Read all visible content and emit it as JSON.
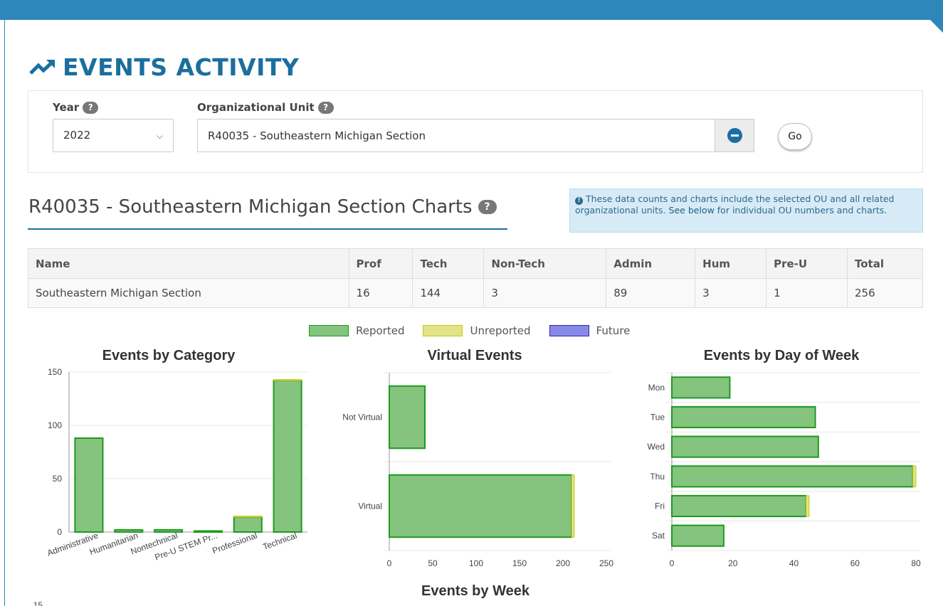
{
  "page": {
    "title": "EVENTS ACTIVITY",
    "title_icon": "trend-up-icon"
  },
  "filters": {
    "year_label": "Year",
    "year_value": "2022",
    "ou_label": "Organizational Unit",
    "ou_value": "R40035 - Southeastern Michigan Section",
    "help_glyph": "?",
    "go_label": "Go"
  },
  "section": {
    "title": "R40035 - Southeastern Michigan Section Charts",
    "info_icon": "info-icon",
    "info_text": "These data counts and charts include the selected OU and all related organizational units.",
    "info_link": "See below",
    "info_text2": "for individual OU numbers and charts."
  },
  "table": {
    "columns": [
      "Name",
      "Prof",
      "Tech",
      "Non-Tech",
      "Admin",
      "Hum",
      "Pre-U",
      "Total"
    ],
    "rows": [
      [
        "Southeastern Michigan Section",
        "16",
        "144",
        "3",
        "89",
        "3",
        "1",
        "256"
      ]
    ]
  },
  "legend": [
    {
      "label": "Reported",
      "color": "#85c47e",
      "border": "#1e9a1e"
    },
    {
      "label": "Unreported",
      "color": "#e3e38a",
      "border": "#c9c91a"
    },
    {
      "label": "Future",
      "color": "#8888e6",
      "border": "#2a2ab8"
    }
  ],
  "colors": {
    "reported_fill": "#85c47e",
    "reported_stroke": "#1e9a1e",
    "unreported_fill": "#e3e38a",
    "unreported_stroke": "#c9c91a",
    "grid": "#e8e8e8",
    "axis": "#999999"
  },
  "chart_data": [
    {
      "type": "bar",
      "title": "Events by Category",
      "categories": [
        "Administrative",
        "Humanitarian",
        "Nontechnical",
        "Pre-U STEM Pr...",
        "Professional",
        "Technical"
      ],
      "series": [
        {
          "name": "Reported",
          "values": [
            88,
            2,
            2,
            1,
            14,
            142
          ]
        },
        {
          "name": "Unreported",
          "values": [
            0,
            0,
            0,
            0,
            1,
            1
          ]
        },
        {
          "name": "Future",
          "values": [
            0,
            0,
            0,
            0,
            0,
            0
          ]
        }
      ],
      "ylim": [
        0,
        150
      ],
      "yticks": [
        0,
        50,
        100,
        150
      ],
      "grid": true
    },
    {
      "type": "bar",
      "orientation": "horizontal",
      "title": "Virtual Events",
      "categories": [
        "Not Virtual",
        "Virtual"
      ],
      "series": [
        {
          "name": "Reported",
          "values": [
            41,
            210
          ]
        },
        {
          "name": "Unreported",
          "values": [
            0,
            3
          ]
        },
        {
          "name": "Future",
          "values": [
            0,
            0
          ]
        }
      ],
      "xlim": [
        0,
        250
      ],
      "xticks": [
        0,
        50,
        100,
        150,
        200,
        250
      ],
      "grid": true
    },
    {
      "type": "bar",
      "orientation": "horizontal",
      "title": "Events by Day of Week",
      "categories": [
        "Mon",
        "Tue",
        "Wed",
        "Thu",
        "Fri",
        "Sat"
      ],
      "series": [
        {
          "name": "Reported",
          "values": [
            19,
            47,
            48,
            79,
            44,
            17
          ]
        },
        {
          "name": "Unreported",
          "values": [
            0,
            0,
            0,
            1,
            1,
            0
          ]
        },
        {
          "name": "Future",
          "values": [
            0,
            0,
            0,
            0,
            0,
            0
          ]
        }
      ],
      "xlim": [
        0,
        80
      ],
      "xticks": [
        0,
        20,
        40,
        60,
        80
      ],
      "grid": true
    },
    {
      "type": "bar",
      "title": "Events by Week",
      "partial_tick": "15"
    }
  ]
}
